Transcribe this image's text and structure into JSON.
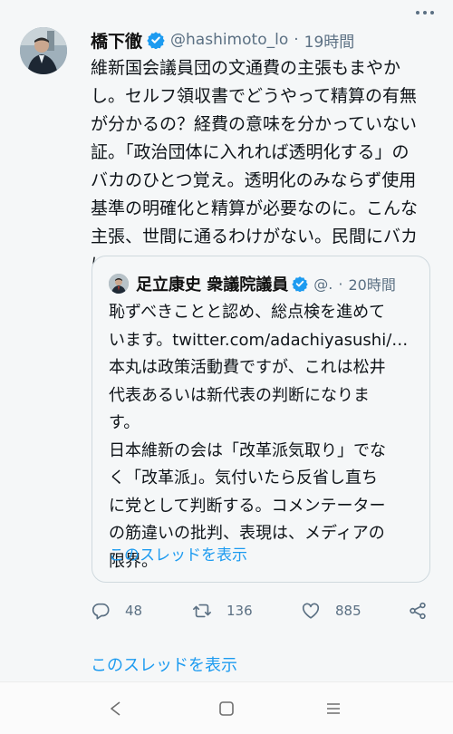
{
  "tweet": {
    "author_name": "橋下徹",
    "handle": "@hashimoto_lo",
    "separator": "·",
    "time": "19時間",
    "text": "維新国会議員団の文通費の主張もまやか\nし。セルフ領収書でどうやって精算の有無\nが分かるの？経費の意味を分かっていない\n証。「政治団体に入れれば透明化する」の\nバカのひとつ覚え。透明化のみならず使用\n基準の明確化と精算が必要なのに。こんな\n主張、世間に通るわけがない。民間にバカ\nにされるだけ。",
    "more_icon": "more-dots-icon",
    "colors": {
      "verified": "#1d9bf0",
      "link": "#1d9bf0",
      "muted": "#5b7083"
    }
  },
  "quoted": {
    "author_name": "足立康史 衆議院議員",
    "handle": "@.",
    "separator": "·",
    "time": "20時間",
    "text": "恥ずべきことと認め、総点検を進めて\nいます。twitter.com/adachiyasushi/…\n本丸は政策活動費ですが、これは松井\n代表あるいは新代表の判断になりま\nす。\n日本維新の会は「改革派気取り」でな\nく「改革派」。気付いたら反省し直ち\nに党として判断する。コメンテーター\nの筋違いの批判、表現は、メディアの\n限界。",
    "show_thread": "このスレッドを表示"
  },
  "actions": {
    "reply_count": "48",
    "retweet_count": "136",
    "like_count": "885",
    "icons": [
      "reply-icon",
      "retweet-icon",
      "like-icon",
      "share-icon"
    ]
  },
  "show_thread": "このスレッドを表示",
  "navbar": {
    "icons": [
      "back-icon",
      "home-icon",
      "recents-icon"
    ]
  }
}
